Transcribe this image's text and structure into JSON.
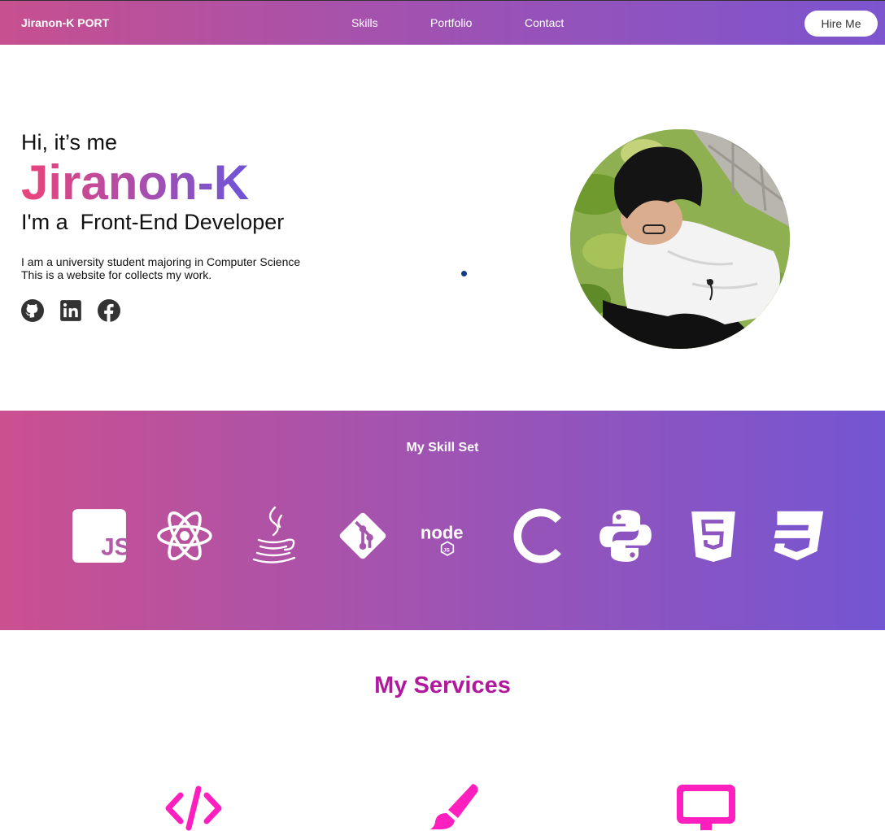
{
  "nav": {
    "brand": "Jiranon-K PORT",
    "links": [
      "Skills",
      "Portfolio",
      "Contact"
    ],
    "hire_label": "Hire Me"
  },
  "hero": {
    "greeting": "Hi, it’s me",
    "name": "Jiranon-K",
    "role": "I'm a  Front-End Developer",
    "desc_line1": "I am a university student majoring in Computer Science",
    "desc_line2": "This is a website for collects my work.",
    "socials": [
      "github-icon",
      "linkedin-icon",
      "facebook-icon"
    ]
  },
  "skills": {
    "title": "My Skill Set",
    "icons": [
      "javascript-icon",
      "react-icon",
      "java-icon",
      "git-icon",
      "nodejs-icon",
      "c-language-icon",
      "python-icon",
      "html5-icon",
      "css3-icon"
    ]
  },
  "services": {
    "title": "My Services",
    "icons": [
      "code-icon",
      "paintbrush-icon",
      "monitor-icon"
    ]
  },
  "colors": {
    "accent_pink": "#ec4379",
    "accent_purple": "#6d55d9",
    "services_title": "#b0199c",
    "service_icon": "#ff1fbf"
  }
}
